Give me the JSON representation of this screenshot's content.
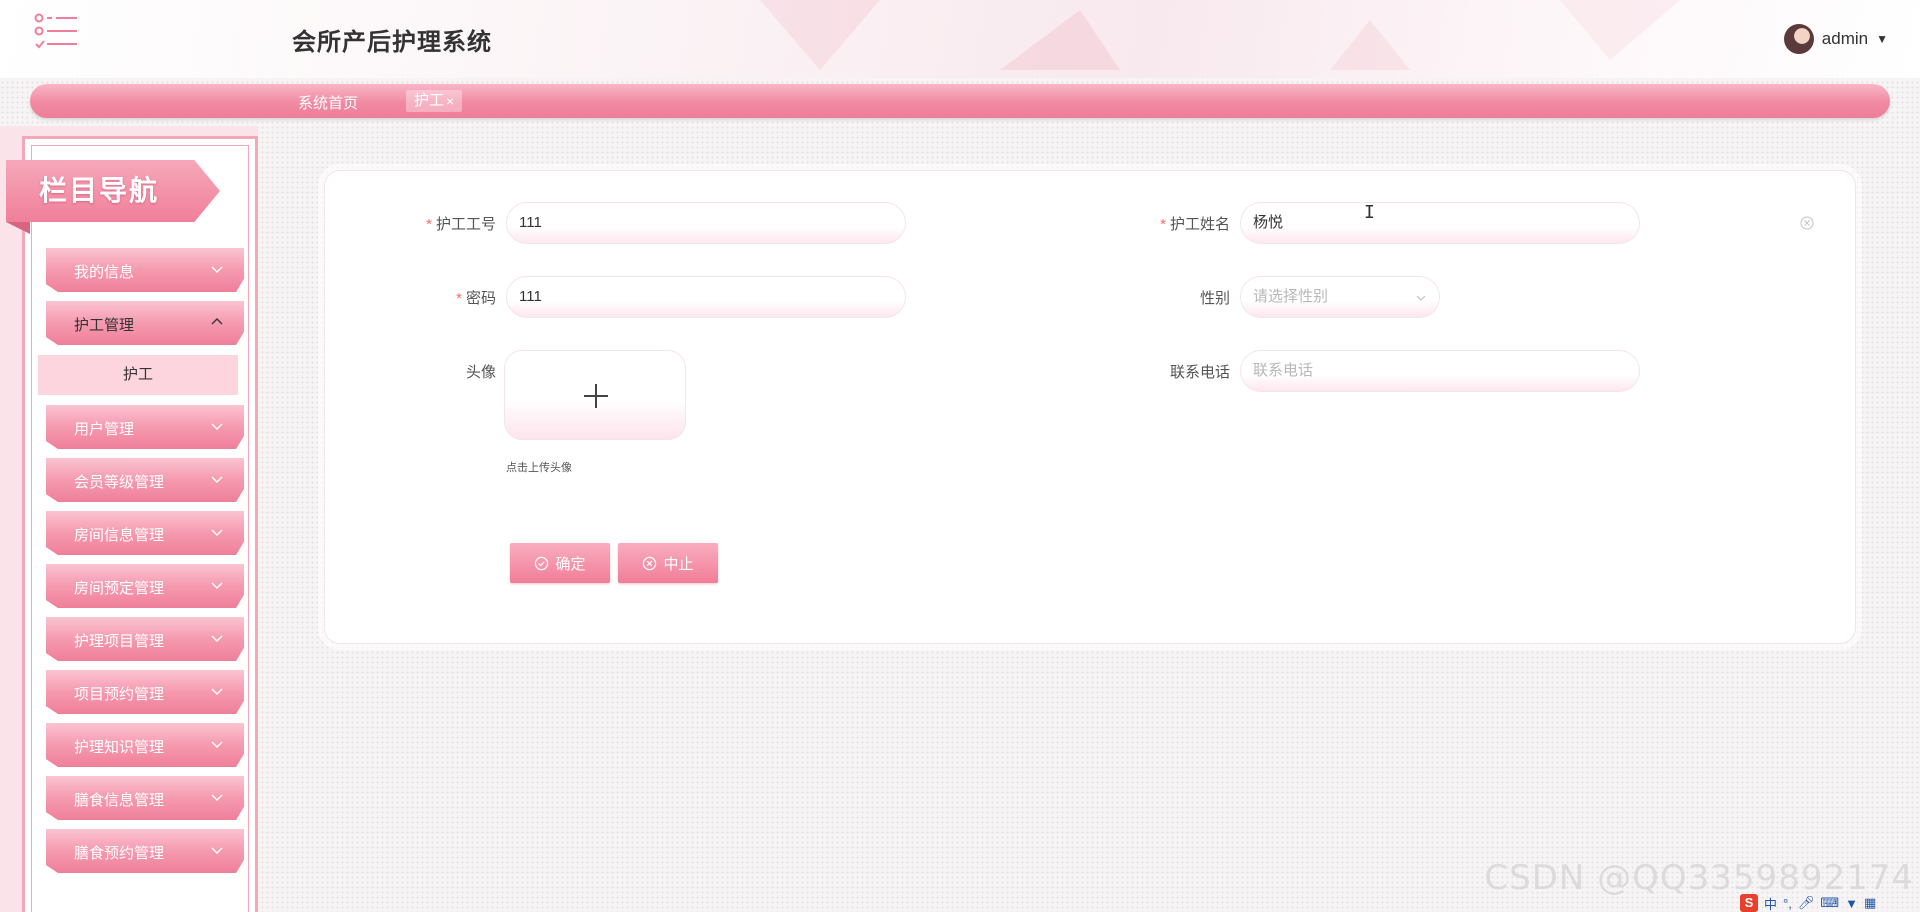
{
  "header": {
    "app_title": "会所产后护理系统",
    "user_name": "admin",
    "menu_icon": "list-menu-icon",
    "avatar_icon": "user-avatar"
  },
  "breadcrumb": {
    "home": "系统首页",
    "active_tab": "护工",
    "close_glyph": "×"
  },
  "sidebar": {
    "title": "栏目导航",
    "items": [
      {
        "label": "我的信息",
        "expanded": false
      },
      {
        "label": "护工管理",
        "expanded": true,
        "children": [
          {
            "label": "护工"
          }
        ]
      },
      {
        "label": "用户管理",
        "expanded": false
      },
      {
        "label": "会员等级管理",
        "expanded": false
      },
      {
        "label": "房间信息管理",
        "expanded": false
      },
      {
        "label": "房间预定管理",
        "expanded": false
      },
      {
        "label": "护理项目管理",
        "expanded": false
      },
      {
        "label": "项目预约管理",
        "expanded": false
      },
      {
        "label": "护理知识管理",
        "expanded": false
      },
      {
        "label": "膳食信息管理",
        "expanded": false
      },
      {
        "label": "膳食预约管理",
        "expanded": false
      }
    ]
  },
  "form": {
    "fields": {
      "worker_id": {
        "label": "护工工号",
        "required": true,
        "value": "111"
      },
      "worker_name": {
        "label": "护工姓名",
        "required": true,
        "value": "杨悦"
      },
      "password": {
        "label": "密码",
        "required": true,
        "value": "111"
      },
      "gender": {
        "label": "性别",
        "required": false,
        "placeholder": "请选择性别"
      },
      "avatar": {
        "label": "头像",
        "hint": "点击上传头像"
      },
      "phone": {
        "label": "联系电话",
        "required": false,
        "placeholder": "联系电话"
      }
    },
    "required_mark": "*",
    "confirm_label": "确定",
    "cancel_label": "中止"
  },
  "colors": {
    "accent_pink": "#f08aa3",
    "required_red": "#f56c6c"
  },
  "watermark": "CSDN @QQ3359892174",
  "tray": {
    "ime_label": "中",
    "ime_punct": "°,"
  }
}
